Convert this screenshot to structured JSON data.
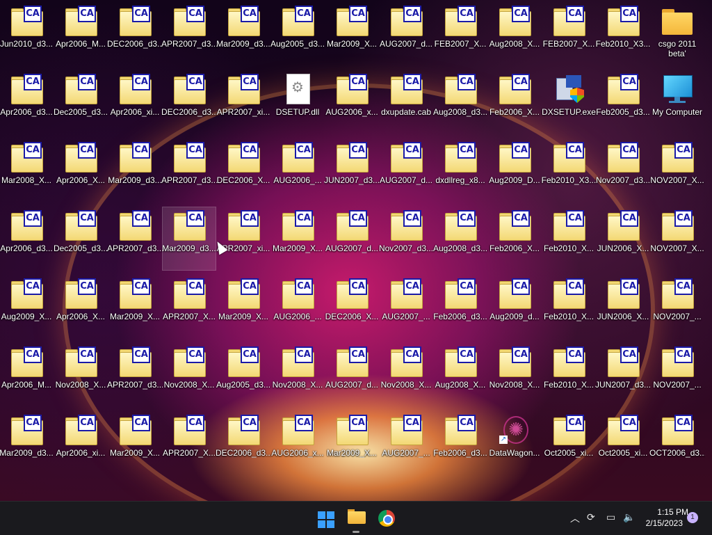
{
  "desktop": {
    "icons": [
      [
        "Jun2010_d3...",
        "Apr2006_M...",
        "DEC2006_d3...",
        "APR2007_d3...",
        "Mar2009_d3...",
        "Aug2005_d3...",
        "Mar2009_X...",
        "AUG2007_d...",
        "FEB2007_X...",
        "Aug2008_X...",
        "FEB2007_X...",
        "Feb2010_X3...",
        "csgo 2011 beta'"
      ],
      [
        "Apr2006_d3...",
        "Dec2005_d3...",
        "Apr2006_xi...",
        "DEC2006_d3...",
        "APR2007_xi...",
        "DSETUP.dll",
        "AUG2006_x...",
        "dxupdate.cab",
        "Aug2008_d3...",
        "Feb2006_X...",
        "DXSETUP.exe",
        "Feb2005_d3...",
        "My Computer"
      ],
      [
        "Mar2008_X...",
        "Apr2006_X...",
        "Mar2009_d3...",
        "APR2007_d3...",
        "DEC2006_X...",
        "AUG2006_...",
        "JUN2007_d3...",
        "AUG2007_d...",
        "dxdllreg_x8...",
        "Aug2009_D...",
        "Feb2010_X3...",
        "Nov2007_d3...",
        "NOV2007_X..."
      ],
      [
        "Apr2006_d3...",
        "Dec2005_d3...",
        "APR2007_d3...",
        "Mar2009_d3...",
        "APR2007_xi...",
        "Mar2009_X...",
        "AUG2007_d...",
        "Nov2007_d3...",
        "Aug2008_d3...",
        "Feb2006_X...",
        "Feb2010_X...",
        "JUN2006_X...",
        "NOV2007_X..."
      ],
      [
        "Aug2009_X...",
        "Apr2006_X...",
        "Mar2009_X...",
        "APR2007_X...",
        "Mar2009_X...",
        "AUG2006_...",
        "DEC2006_X...",
        "AUG2007_...",
        "Feb2006_d3...",
        "Aug2009_d...",
        "Feb2010_X...",
        "JUN2006_X...",
        "NOV2007_..."
      ],
      [
        "Apr2006_M...",
        "Nov2008_X...",
        "APR2007_d3...",
        "Nov2008_X...",
        "Aug2005_d3...",
        "Nov2008_X...",
        "AUG2007_d...",
        "Nov2008_X...",
        "Aug2008_X...",
        "Nov2008_X...",
        "Feb2010_X...",
        "JUN2007_d3...",
        "NOV2007_..."
      ],
      [
        "Mar2009_d3...",
        "Apr2006_xi...",
        "Mar2009_X...",
        "APR2007_X...",
        "DEC2006_d3...",
        "AUG2006_x...",
        "Mar2009_X...",
        "AUG2007_...",
        "Feb2006_d3...",
        "DataWagon...",
        "Oct2005_xi...",
        "Oct2005_xi...",
        "OCT2006_d3..."
      ]
    ],
    "special_icons": {
      "0-12": "folder-icon",
      "1-5": "dll-icon",
      "1-10": "setup-exe-icon",
      "1-12": "computer-icon",
      "6-9": "datawagon-shortcut-icon"
    },
    "cab_badge": "CA",
    "selected": "3-3"
  },
  "taskbar": {
    "start": "windows-start-icon",
    "pinned": [
      "file-explorer-icon",
      "chrome-icon"
    ],
    "tray": [
      "chevron-up-icon",
      "sync-icon",
      "network-icon",
      "volume-icon"
    ],
    "clock_time": "1:15 PM",
    "clock_date": "2/15/2023",
    "notification_count": "1"
  }
}
